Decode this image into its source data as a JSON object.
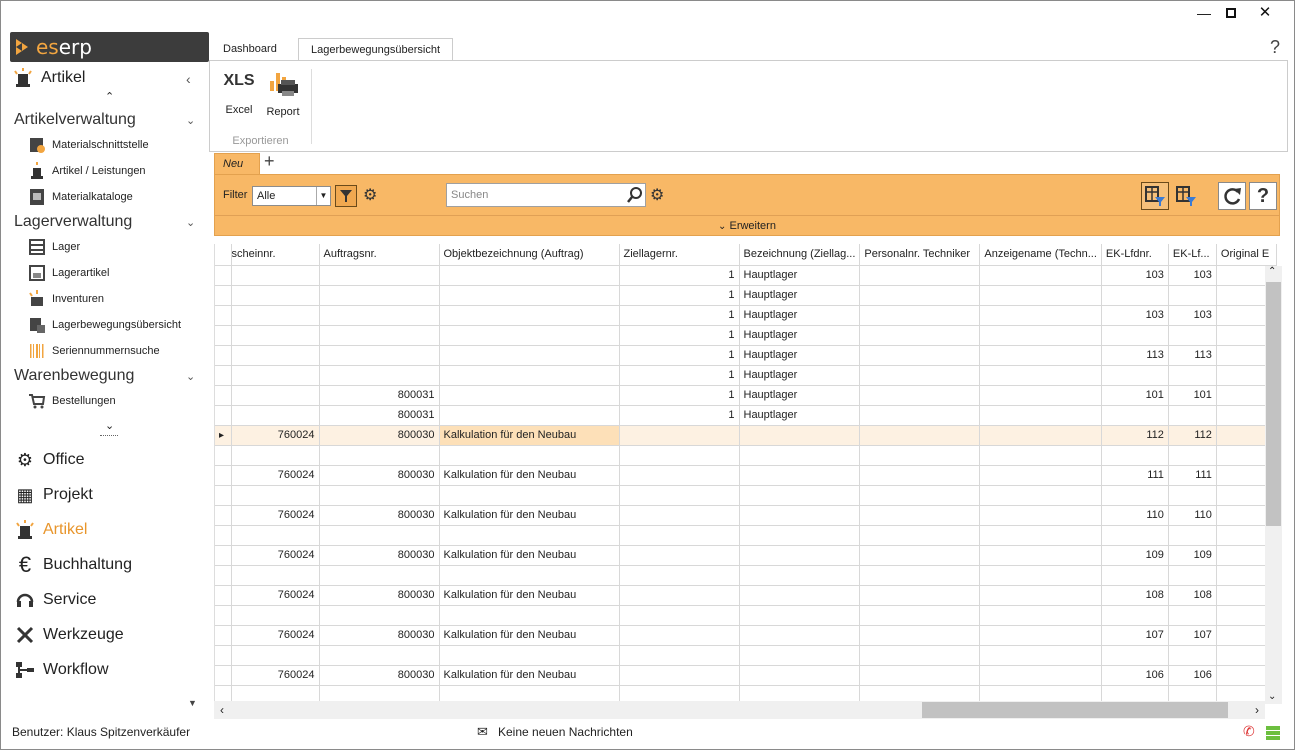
{
  "window": {
    "min": "—",
    "max": "☐",
    "close": "✕"
  },
  "logo": {
    "es": "es",
    "erp": "erp"
  },
  "sidebar": {
    "top_module": "Artikel",
    "groups": [
      {
        "title": "Artikelverwaltung",
        "items": [
          {
            "label": "Materialschnittstelle",
            "icon": "interface-icon"
          },
          {
            "label": "Artikel / Leistungen",
            "icon": "beacon-icon"
          },
          {
            "label": "Materialkataloge",
            "icon": "catalog-icon"
          }
        ]
      },
      {
        "title": "Lagerverwaltung",
        "items": [
          {
            "label": "Lager",
            "icon": "warehouse-icon"
          },
          {
            "label": "Lagerartikel",
            "icon": "stock-item-icon"
          },
          {
            "label": "Inventuren",
            "icon": "inventory-icon"
          },
          {
            "label": "Lagerbewegungsübersicht",
            "icon": "movement-icon"
          },
          {
            "label": "Seriennummernsuche",
            "icon": "barcode-icon"
          }
        ]
      },
      {
        "title": "Warenbewegung",
        "items": [
          {
            "label": "Bestellungen",
            "icon": "cart-icon"
          }
        ]
      }
    ],
    "modules": [
      {
        "label": "Office",
        "icon": "⚙"
      },
      {
        "label": "Projekt",
        "icon": "▦"
      },
      {
        "label": "Artikel",
        "icon": "🚨",
        "active": true
      },
      {
        "label": "Buchhaltung",
        "icon": "€"
      },
      {
        "label": "Service",
        "icon": "🎧"
      },
      {
        "label": "Werkzeuge",
        "icon": "✖"
      },
      {
        "label": "Workflow",
        "icon": "⊢"
      }
    ]
  },
  "tabs": {
    "dashboard": "Dashboard",
    "active": "Lagerbewegungsübersicht"
  },
  "help": "?",
  "ribbon": {
    "excel_big": "XLS",
    "excel": "Excel",
    "report": "Report",
    "group": "Exportieren"
  },
  "subtabs": {
    "neu": "Neu",
    "add": "+"
  },
  "toolbar": {
    "filter_label": "Filter",
    "filter_value": "Alle",
    "search_placeholder": "Suchen",
    "expand": "Erweitern"
  },
  "grid": {
    "columns": [
      "scheinnr.",
      "Auftragsnr.",
      "Objektbezeichnung (Auftrag)",
      "Ziellagernr.",
      "Bezeichnung (Ziellag...",
      "Personalnr. Techniker",
      "Anzeigename (Techn...",
      "EK-Lfdnr.",
      "EK-Lf...",
      "Original E"
    ],
    "rows": [
      [
        "",
        "",
        "",
        "1",
        "Hauptlager",
        "",
        "",
        "103",
        "103",
        ""
      ],
      [
        "",
        "",
        "",
        "1",
        "Hauptlager",
        "",
        "",
        "",
        "",
        ""
      ],
      [
        "",
        "",
        "",
        "1",
        "Hauptlager",
        "",
        "",
        "103",
        "103",
        ""
      ],
      [
        "",
        "",
        "",
        "1",
        "Hauptlager",
        "",
        "",
        "",
        "",
        ""
      ],
      [
        "",
        "",
        "",
        "1",
        "Hauptlager",
        "",
        "",
        "113",
        "113",
        ""
      ],
      [
        "",
        "",
        "",
        "1",
        "Hauptlager",
        "",
        "",
        "",
        "",
        ""
      ],
      [
        "",
        "800031",
        "",
        "1",
        "Hauptlager",
        "",
        "",
        "101",
        "101",
        ""
      ],
      [
        "",
        "800031",
        "",
        "1",
        "Hauptlager",
        "",
        "",
        "",
        "",
        ""
      ],
      [
        "760024",
        "800030",
        "Kalkulation für den Neubau",
        "",
        "",
        "",
        "",
        "112",
        "112",
        ""
      ],
      [
        "",
        "",
        "",
        "",
        "",
        "",
        "",
        "",
        "",
        ""
      ],
      [
        "760024",
        "800030",
        "Kalkulation für den Neubau",
        "",
        "",
        "",
        "",
        "111",
        "111",
        ""
      ],
      [
        "",
        "",
        "",
        "",
        "",
        "",
        "",
        "",
        "",
        ""
      ],
      [
        "760024",
        "800030",
        "Kalkulation für den Neubau",
        "",
        "",
        "",
        "",
        "110",
        "110",
        ""
      ],
      [
        "",
        "",
        "",
        "",
        "",
        "",
        "",
        "",
        "",
        ""
      ],
      [
        "760024",
        "800030",
        "Kalkulation für den Neubau",
        "",
        "",
        "",
        "",
        "109",
        "109",
        ""
      ],
      [
        "",
        "",
        "",
        "",
        "",
        "",
        "",
        "",
        "",
        ""
      ],
      [
        "760024",
        "800030",
        "Kalkulation für den Neubau",
        "",
        "",
        "",
        "",
        "108",
        "108",
        ""
      ],
      [
        "",
        "",
        "",
        "",
        "",
        "",
        "",
        "",
        "",
        ""
      ],
      [
        "760024",
        "800030",
        "Kalkulation für den Neubau",
        "",
        "",
        "",
        "",
        "107",
        "107",
        ""
      ],
      [
        "",
        "",
        "",
        "",
        "",
        "",
        "",
        "",
        "",
        ""
      ],
      [
        "760024",
        "800030",
        "Kalkulation für den Neubau",
        "",
        "",
        "",
        "",
        "106",
        "106",
        ""
      ],
      [
        "",
        "",
        "",
        "",
        "",
        "",
        "",
        "",
        "",
        ""
      ]
    ],
    "selected_row": 8
  },
  "status": {
    "user": "Benutzer: Klaus Spitzenverkäufer",
    "messages": "Keine neuen Nachrichten"
  },
  "colors": {
    "accent": "#f8b866",
    "brand": "#f2a540",
    "active_module": "#e8952b"
  }
}
